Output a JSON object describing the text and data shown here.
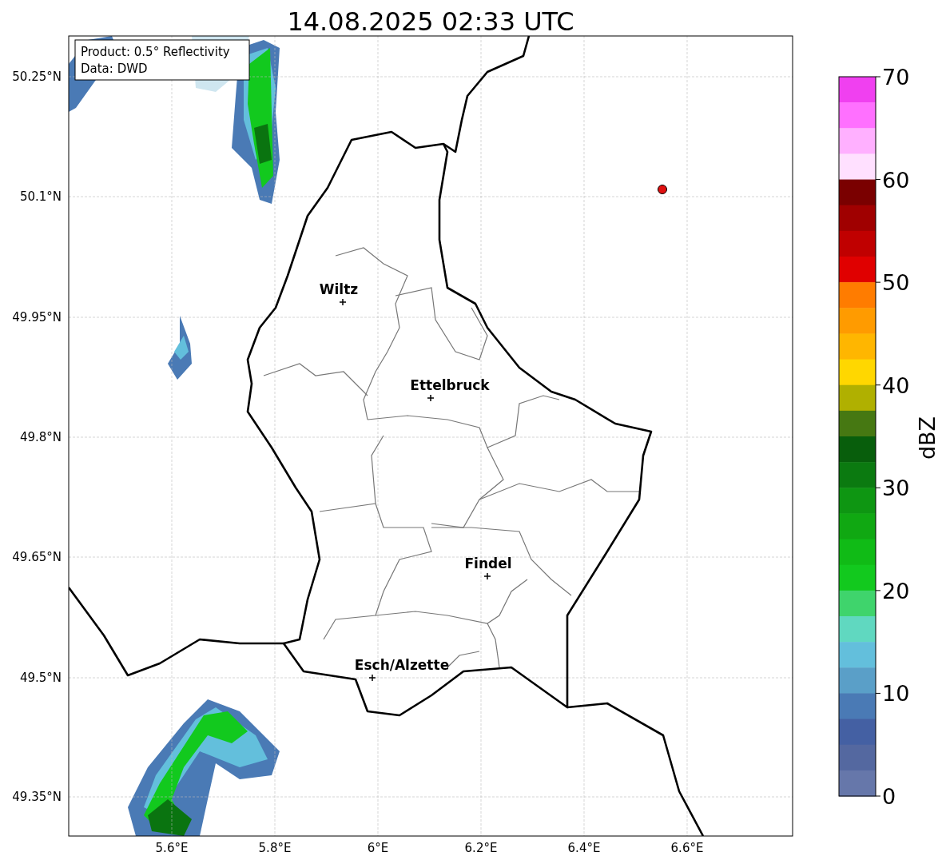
{
  "title": "14.08.2025 02:33 UTC",
  "legend": [
    "Product: 0.5° Reflectivity",
    "Data: DWD"
  ],
  "y_ticks": [
    "50.25°N",
    "50.1°N",
    "49.95°N",
    "49.8°N",
    "49.65°N",
    "49.5°N",
    "49.35°N"
  ],
  "x_ticks": [
    "5.6°E",
    "5.8°E",
    "6°E",
    "6.2°E",
    "6.4°E",
    "6.6°E"
  ],
  "cities": [
    {
      "name": "Wiltz"
    },
    {
      "name": "Ettelbruck"
    },
    {
      "name": "Findel"
    },
    {
      "name": "Esch/Alzette"
    }
  ],
  "colorbar": {
    "label": "dBZ",
    "ticks": [
      "70",
      "60",
      "50",
      "40",
      "30",
      "20",
      "10",
      "0"
    ],
    "segments": [
      {
        "color": "#f040f0"
      },
      {
        "color": "#ff70ff"
      },
      {
        "color": "#ffb0ff"
      },
      {
        "color": "#ffe0ff"
      },
      {
        "color": "#7a0000"
      },
      {
        "color": "#a00000"
      },
      {
        "color": "#c00000"
      },
      {
        "color": "#e00000"
      },
      {
        "color": "#ff7c00"
      },
      {
        "color": "#ff9b00"
      },
      {
        "color": "#ffb600"
      },
      {
        "color": "#ffd700"
      },
      {
        "color": "#b0b000"
      },
      {
        "color": "#467812"
      },
      {
        "color": "#085e0c"
      },
      {
        "color": "#0b7a10"
      },
      {
        "color": "#0e9612"
      },
      {
        "color": "#10a812"
      },
      {
        "color": "#10bb16"
      },
      {
        "color": "#12c91e"
      },
      {
        "color": "#3fd46c"
      },
      {
        "color": "#60d8c0"
      },
      {
        "color": "#63bfdc"
      },
      {
        "color": "#5a9fc8"
      },
      {
        "color": "#4a7ab5"
      },
      {
        "color": "#4460a3"
      },
      {
        "color": "#5468a0"
      },
      {
        "color": "#6677aa"
      }
    ]
  }
}
